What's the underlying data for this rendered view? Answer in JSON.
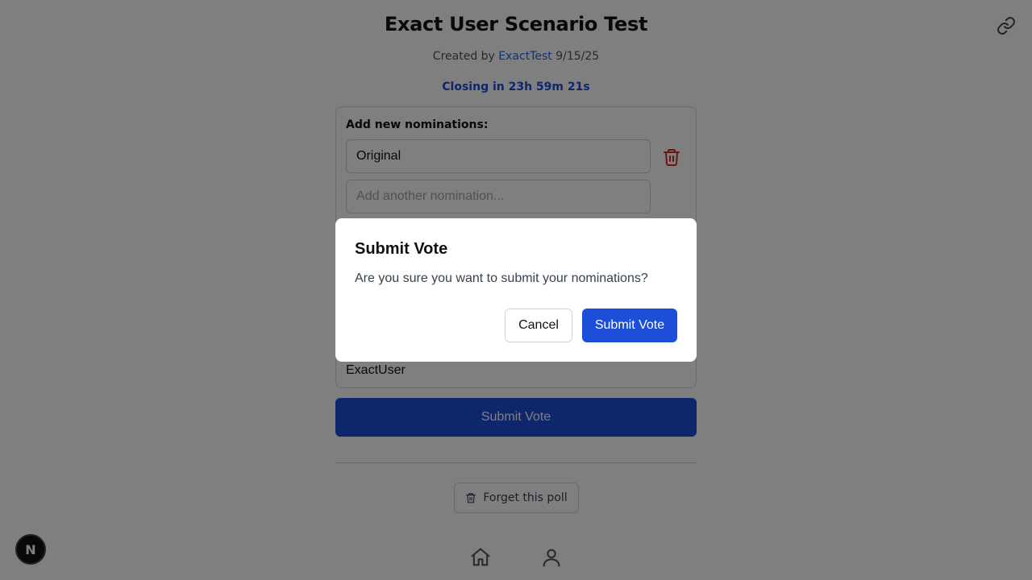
{
  "header": {
    "title": "Exact User Scenario Test",
    "created_prefix": "Created by",
    "creator": "ExactTest",
    "date": "9/15/25",
    "closing": "Closing in 23h 59m 21s"
  },
  "nominations": {
    "label": "Add new nominations:",
    "first_value": "Original",
    "new_placeholder": "Add another nomination..."
  },
  "voter": {
    "name": "ExactUser"
  },
  "actions": {
    "submit_label": "Submit Vote",
    "forget_label": "Forget this poll"
  },
  "dialog": {
    "title": "Submit Vote",
    "message": "Are you sure you want to submit your nominations?",
    "cancel_label": "Cancel",
    "confirm_label": "Submit Vote"
  },
  "dev_badge": {
    "letter": "N"
  },
  "colors": {
    "accent": "#1d4ed8",
    "danger": "#dc2626",
    "overlay": "rgba(0,0,0,0.5)"
  },
  "icons": [
    "link-icon",
    "trash-icon",
    "home-icon",
    "user-icon"
  ]
}
